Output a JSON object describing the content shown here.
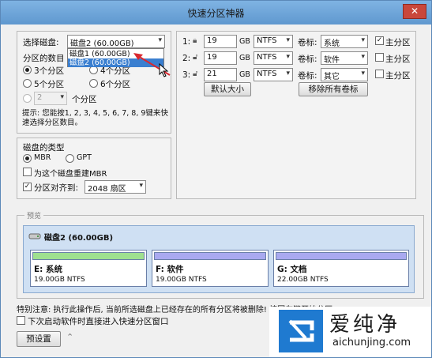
{
  "window": {
    "title": "快速分区神器",
    "close": "✕"
  },
  "left": {
    "disk_label": "选择磁盘:",
    "disk_selected": "磁盘2 (60.00GB)",
    "disk_options": [
      "磁盘1 (60.00GB)",
      "磁盘2 (60.00GB)"
    ],
    "partition_count_label": "分区的数目",
    "options": [
      "3个分区",
      "4个分区",
      "5个分区",
      "6个分区"
    ],
    "custom_value": "2",
    "custom_label": "个分区",
    "hint": "提示: 您能按1, 2, 3, 4, 5, 6, 7, 8, 9键来快速选择分区数目。"
  },
  "disk_type": {
    "title": "磁盘的类型",
    "mbr": "MBR",
    "gpt": "GPT",
    "rebuild_mbr": "为这个磁盘重建MBR",
    "align_label": "分区对齐到:",
    "align_value": "2048 扇区"
  },
  "partitions_config": {
    "unit": "GB",
    "vol_label": "卷标:",
    "primary_label": "主分区",
    "rows": [
      {
        "num": "1:",
        "size": "19",
        "fs": "NTFS",
        "label": "系统",
        "primary": true
      },
      {
        "num": "2:",
        "size": "19",
        "fs": "NTFS",
        "label": "软件",
        "primary": false
      },
      {
        "num": "3:",
        "size": "21",
        "fs": "NTFS",
        "label": "其它",
        "primary": false
      }
    ],
    "default_size_btn": "默认大小",
    "remove_labels_btn": "移除所有卷标"
  },
  "preview": {
    "group_label": "预览",
    "disk_title": "磁盘2 (60.00GB)",
    "parts": [
      {
        "name": "E: 系统",
        "size": "19.00GB NTFS",
        "color": "#9fe08f"
      },
      {
        "name": "F: 软件",
        "size": "19.00GB NTFS",
        "color": "#a9a9f0"
      },
      {
        "name": "G: 文档",
        "size": "22.00GB NTFS",
        "color": "#a9a9f0"
      }
    ]
  },
  "bottom": {
    "warning": "特别注意: 执行此操作后, 当前所选磁盘上已经存在的所有分区将被删除! 按回车键开始分区.",
    "auto_enter": "下次启动软件时直接进入快速分区窗口",
    "preset_btn": "预设置"
  },
  "watermark": {
    "brand": "爱纯净",
    "url": "aichunjing.com"
  }
}
